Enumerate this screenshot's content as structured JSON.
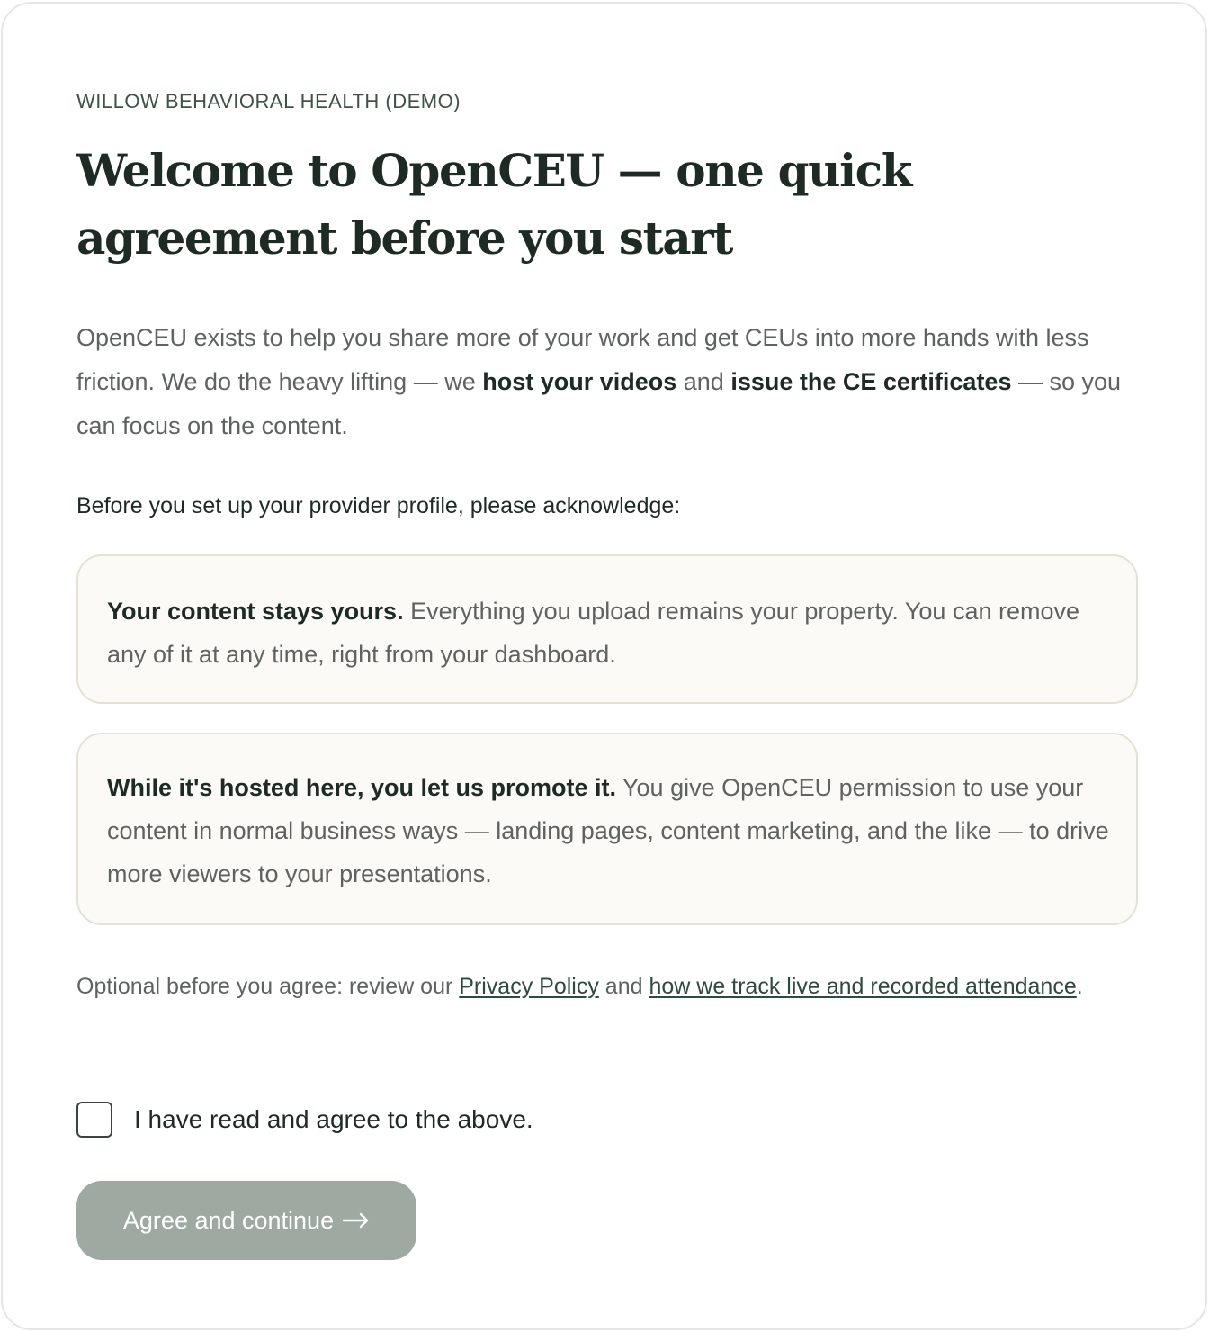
{
  "org_name": "WILLOW BEHAVIORAL HEALTH (DEMO)",
  "title": "Welcome to OpenCEU — one quick agreement before you start",
  "intro": {
    "part1": "OpenCEU exists to help you share more of your work and get CEUs into more hands with less friction. We do the heavy lifting — we ",
    "bold1": "host your videos",
    "part2": " and ",
    "bold2": "issue the CE certificates",
    "part3": " — so you can focus on the content."
  },
  "prompt": "Before you set up your provider profile, please acknowledge:",
  "acknowledgements": [
    {
      "heading": "Your content stays yours.",
      "body": " Everything you upload remains your property. You can remove any of it at any time, right from your dashboard."
    },
    {
      "heading": "While it's hosted here, you let us promote it.",
      "body": " You give OpenCEU permission to use your content in normal business ways — landing pages, content marketing, and the like — to drive more viewers to your presentations."
    }
  ],
  "optional": {
    "prefix": "Optional before you agree: review our ",
    "privacy_link": "Privacy Policy",
    "middle": " and ",
    "attendance_link": "how we track live and recorded attendance",
    "suffix": "."
  },
  "agreement_checkbox": {
    "label": "I have read and agree to the above.",
    "checked": false
  },
  "continue_button": {
    "label": "Agree and continue",
    "icon": "arrow-right-icon",
    "disabled": true
  },
  "colors": {
    "heading": "#1e2a24",
    "accent_green": "#2f4a3e",
    "muted_text": "#5f6360",
    "box_background": "#fbfaf6",
    "button_disabled": "#9ea9a1"
  }
}
